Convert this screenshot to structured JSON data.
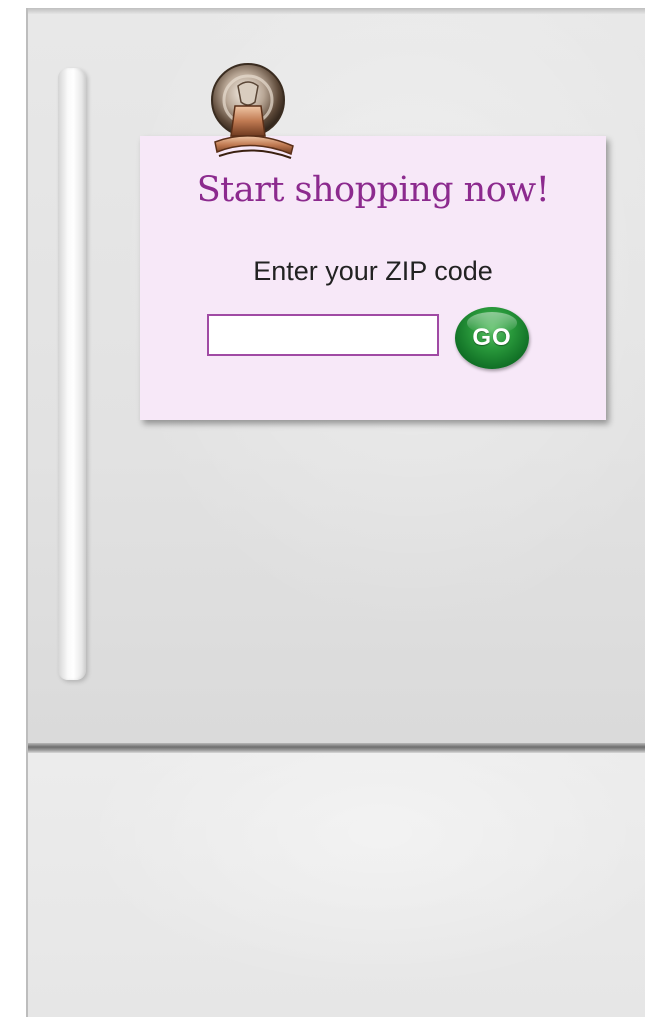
{
  "card": {
    "title": "Start shopping now!",
    "zip_label": "Enter your ZIP code",
    "zip_value": "",
    "go_label": "GO"
  },
  "colors": {
    "card_background": "#f7e8f8",
    "title_color": "#8c2a8e",
    "input_border": "#a04aa4",
    "go_button": "#1f8a34"
  },
  "icons": {
    "clip": "magnet-clip-icon"
  }
}
